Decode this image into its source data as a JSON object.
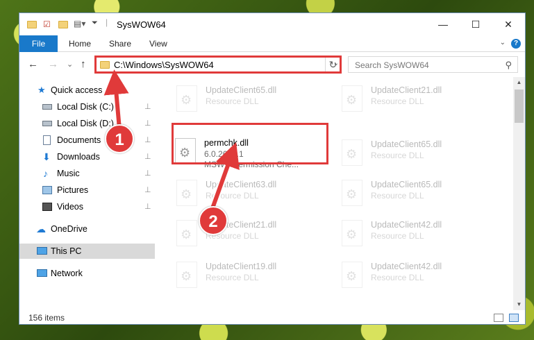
{
  "window": {
    "title": "SysWOW64",
    "minimize": "—",
    "maximize": "☐",
    "close": "✕"
  },
  "ribbon": {
    "file": "File",
    "tabs": [
      "Home",
      "Share",
      "View"
    ],
    "help": "?",
    "collapse": "⌄"
  },
  "nav": {
    "back": "←",
    "forward": "→",
    "recent": "⌄",
    "up": "↑",
    "address": "C:\\Windows\\SysWOW64",
    "address_dropdown": "⌄",
    "refresh": "↻",
    "search_placeholder": "Search SysWOW64",
    "search_icon": "⚲"
  },
  "sidebar": {
    "items": [
      {
        "label": "Quick access",
        "icon": "star-icon",
        "pinned": false
      },
      {
        "label": "Local Disk (C:)",
        "icon": "drive-icon",
        "pinned": true
      },
      {
        "label": "Local Disk (D:)",
        "icon": "drive-icon",
        "pinned": true
      },
      {
        "label": "Documents",
        "icon": "documents-icon",
        "pinned": true
      },
      {
        "label": "Downloads",
        "icon": "download-icon",
        "pinned": true
      },
      {
        "label": "Music",
        "icon": "music-icon",
        "pinned": true
      },
      {
        "label": "Pictures",
        "icon": "pictures-icon",
        "pinned": true
      },
      {
        "label": "Videos",
        "icon": "videos-icon",
        "pinned": true
      },
      {
        "label": "OneDrive",
        "icon": "cloud-icon",
        "pinned": false
      },
      {
        "label": "This PC",
        "icon": "computer-icon",
        "pinned": false,
        "selected": true
      },
      {
        "label": "Network",
        "icon": "network-icon",
        "pinned": false
      }
    ],
    "pin_glyph": "📌"
  },
  "files": {
    "highlighted": {
      "name": "permchk.dll",
      "version": "6.0.2600.1",
      "description": "MSWC Permission Che..."
    },
    "left_column": [
      {
        "name": "UpdateClient65.dll",
        "type": "Resource DLL"
      },
      {
        "name": "UpdateClient63.dll",
        "type": "Resource DLL"
      },
      {
        "name": "UpdateClient21.dll",
        "type": "Resource DLL"
      },
      {
        "name": "UpdateClient19.dll",
        "type": "Resource DLL"
      }
    ],
    "right_column": [
      {
        "name": "UpdateClient21.dll",
        "type": "Resource DLL"
      },
      {
        "name": "UpdateClient65.dll",
        "type": "Resource DLL"
      },
      {
        "name": "UpdateClient65.dll",
        "type": "Resource DLL"
      },
      {
        "name": "UpdateClient42.dll",
        "type": "Resource DLL"
      },
      {
        "name": "UpdateClient42.dll",
        "type": "Resource DLL"
      }
    ]
  },
  "status": {
    "items": "156 items"
  },
  "callouts": [
    "1",
    "2"
  ],
  "colors": {
    "accent": "#1979ca",
    "highlight": "#e03a3a"
  }
}
